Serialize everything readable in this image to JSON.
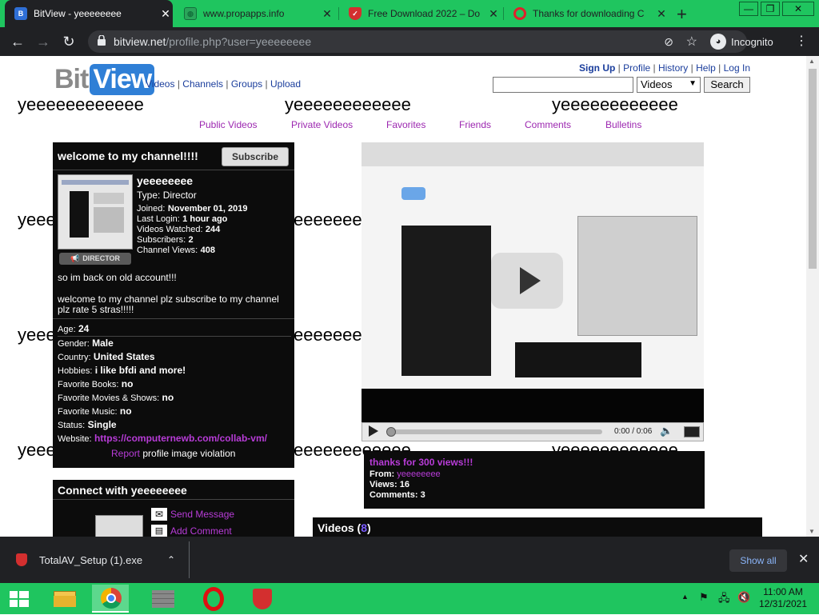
{
  "browser": {
    "tabs": [
      {
        "title": "BitView - yeeeeeeee",
        "favicon": "bitview-icon",
        "active": true
      },
      {
        "title": "www.propapps.info",
        "favicon": "globe-icon",
        "active": false
      },
      {
        "title": "Free Download 2022 – Do",
        "favicon": "shield-icon",
        "active": false
      },
      {
        "title": "Thanks for downloading C",
        "favicon": "opera-icon",
        "active": false
      }
    ],
    "new_tab": "+",
    "url_domain": "bitview.net",
    "url_path": "/profile.php?user=yeeeeeeee",
    "incognito_label": "Incognito"
  },
  "site": {
    "logo_bit": "Bit",
    "logo_view": "View",
    "nav": [
      "Videos",
      "Channels",
      "Groups",
      "Upload"
    ],
    "top_links": [
      "Sign Up",
      "Profile",
      "History",
      "Help",
      "Log In"
    ],
    "search_placeholder": "",
    "search_scope": "Videos",
    "search_button": "Search"
  },
  "watermark_text": "yeeeeeeeeeeee",
  "profile_tabs": [
    "Public Videos",
    "Private Videos",
    "Favorites",
    "Friends",
    "Comments",
    "Bulletins"
  ],
  "channel": {
    "heading": "welcome to my channel!!!!",
    "subscribe": "Subscribe",
    "username": "yeeeeeeee",
    "type_label": "Type:",
    "type_value": "Director",
    "badge": "DIRECTOR",
    "joined_label": "Joined:",
    "joined": "November 01, 2019",
    "last_login_label": "Last Login:",
    "last_login": "1 hour ago",
    "videos_watched_label": "Videos Watched:",
    "videos_watched": "244",
    "subscribers_label": "Subscribers:",
    "subscribers": "2",
    "views_label": "Channel Views:",
    "views": "408",
    "bio_1": "so im back on old account!!!",
    "bio_2": "welcome to my channel plz subscribe to my channel plz rate 5 stras!!!!!",
    "details": [
      {
        "label": "Age:",
        "value": "24"
      },
      {
        "label": "Gender:",
        "value": "Male"
      },
      {
        "label": "Country:",
        "value": "United States"
      },
      {
        "label": "Hobbies:",
        "value": "i like bfdi and more!"
      },
      {
        "label": "Favorite Books:",
        "value": "no"
      },
      {
        "label": "Favorite Movies & Shows:",
        "value": "no"
      },
      {
        "label": "Favorite Music:",
        "value": "no"
      },
      {
        "label": "Status:",
        "value": "Single"
      }
    ],
    "website_label": "Website:",
    "website": "https://computernewb.com/collab-vm/",
    "report_link": "Report",
    "report_text": " profile image violation"
  },
  "connect": {
    "heading": "Connect with yeeeeeeee",
    "send_message": "Send Message",
    "add_comment": "Add Comment"
  },
  "player": {
    "time": "0:00 / 0:06",
    "progress": 0
  },
  "video_info": {
    "title": "thanks for 300 views!!!",
    "from_label": "From:",
    "from": "yeeeeeeee",
    "views_label": "Views:",
    "views": "16",
    "comments_label": "Comments:",
    "comments": "3"
  },
  "videos_section": {
    "heading": "Videos",
    "count": "8"
  },
  "download": {
    "file": "TotalAV_Setup (1).exe",
    "show_all": "Show all"
  },
  "taskbar": {
    "time": "11:00 AM",
    "date": "12/31/2021"
  },
  "colors": {
    "chrome_green": "#1fc55f",
    "chrome_dark": "#202124",
    "link_blue": "#1a3d9c",
    "tab_purple": "#9c27b0",
    "link_violet": "#b83cd8"
  }
}
